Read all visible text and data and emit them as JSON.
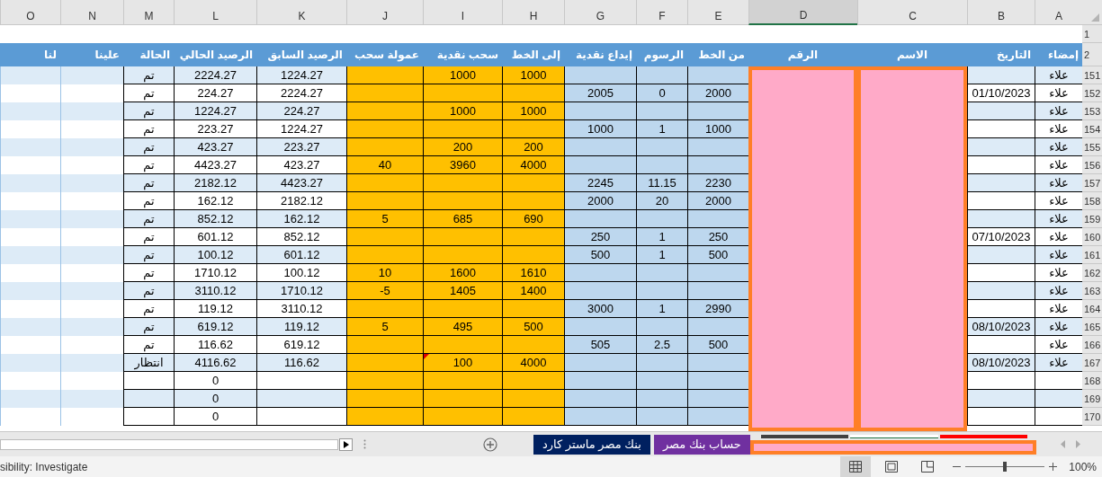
{
  "column_letters": [
    {
      "label": "O",
      "selected": false
    },
    {
      "label": "N",
      "selected": false
    },
    {
      "label": "M",
      "selected": false
    },
    {
      "label": "L",
      "selected": false
    },
    {
      "label": "K",
      "selected": false
    },
    {
      "label": "J",
      "selected": false
    },
    {
      "label": "I",
      "selected": false
    },
    {
      "label": "H",
      "selected": false
    },
    {
      "label": "G",
      "selected": false
    },
    {
      "label": "F",
      "selected": false
    },
    {
      "label": "E",
      "selected": false
    },
    {
      "label": "D",
      "selected": true
    },
    {
      "label": "C",
      "selected": false
    },
    {
      "label": "B",
      "selected": false
    },
    {
      "label": "A",
      "selected": false
    }
  ],
  "columns": [
    {
      "heading": "إمضاء",
      "kind": "striped"
    },
    {
      "heading": "التاريخ",
      "kind": "striped"
    },
    {
      "heading": "الاسم",
      "kind": "redacted"
    },
    {
      "heading": "الرقم",
      "kind": "redacted"
    },
    {
      "heading": "من الخط",
      "kind": "blue"
    },
    {
      "heading": "الرسوم",
      "kind": "blue"
    },
    {
      "heading": "إيداع نقدية",
      "kind": "blue"
    },
    {
      "heading": "إلى الخط",
      "kind": "orange"
    },
    {
      "heading": "سحب نقدية",
      "kind": "orange"
    },
    {
      "heading": "عمولة سحب",
      "kind": "orange"
    },
    {
      "heading": "الرصيد السابق",
      "kind": "striped"
    },
    {
      "heading": "الرصيد الحالي",
      "kind": "striped"
    },
    {
      "heading": "الحالة",
      "kind": "striped"
    },
    {
      "heading": "علينا",
      "kind": "open"
    },
    {
      "heading": "لنا",
      "kind": "open"
    }
  ],
  "header_rows": [
    "1",
    "2"
  ],
  "rows": [
    {
      "number": "151",
      "has_comment": false,
      "cells": [
        {},
        {},
        {
          "text": "تم"
        },
        {
          "text": "2224.27"
        },
        {
          "text": "1224.27"
        },
        {},
        {
          "text": "1000"
        },
        {
          "text": "1000"
        },
        {},
        {},
        {},
        {},
        {
          "text": "علاء"
        }
      ]
    },
    {
      "number": "152",
      "has_comment": false,
      "cells": [
        {},
        {},
        {
          "text": "تم"
        },
        {
          "text": "224.27"
        },
        {
          "text": "2224.27"
        },
        {},
        {},
        {},
        {
          "text": "2005"
        },
        {
          "text": "0"
        },
        {
          "text": "2000"
        },
        {
          "text": "01/10/2023"
        },
        {
          "text": "علاء"
        }
      ]
    },
    {
      "number": "153",
      "has_comment": false,
      "cells": [
        {},
        {},
        {
          "text": "تم"
        },
        {
          "text": "1224.27"
        },
        {
          "text": "224.27"
        },
        {},
        {
          "text": "1000"
        },
        {
          "text": "1000"
        },
        {},
        {},
        {},
        {},
        {
          "text": "علاء"
        }
      ]
    },
    {
      "number": "154",
      "has_comment": false,
      "cells": [
        {},
        {},
        {
          "text": "تم"
        },
        {
          "text": "223.27"
        },
        {
          "text": "1224.27"
        },
        {},
        {},
        {},
        {
          "text": "1000"
        },
        {
          "text": "1"
        },
        {
          "text": "1000"
        },
        {},
        {
          "text": "علاء"
        }
      ]
    },
    {
      "number": "155",
      "has_comment": false,
      "cells": [
        {},
        {},
        {
          "text": "تم"
        },
        {
          "text": "423.27"
        },
        {
          "text": "223.27"
        },
        {},
        {
          "text": "200"
        },
        {
          "text": "200"
        },
        {},
        {},
        {},
        {},
        {
          "text": "علاء"
        }
      ]
    },
    {
      "number": "156",
      "has_comment": false,
      "cells": [
        {},
        {},
        {
          "text": "تم"
        },
        {
          "text": "4423.27"
        },
        {
          "text": "423.27"
        },
        {
          "text": "40"
        },
        {
          "text": "3960"
        },
        {
          "text": "4000"
        },
        {},
        {},
        {},
        {},
        {
          "text": "علاء"
        }
      ]
    },
    {
      "number": "157",
      "has_comment": false,
      "cells": [
        {},
        {},
        {
          "text": "تم"
        },
        {
          "text": "2182.12"
        },
        {
          "text": "4423.27"
        },
        {},
        {},
        {},
        {
          "text": "2245"
        },
        {
          "text": "11.15"
        },
        {
          "text": "2230"
        },
        {},
        {
          "text": "علاء"
        }
      ]
    },
    {
      "number": "158",
      "has_comment": false,
      "cells": [
        {},
        {},
        {
          "text": "تم"
        },
        {
          "text": "162.12"
        },
        {
          "text": "2182.12"
        },
        {},
        {},
        {},
        {
          "text": "2000"
        },
        {
          "text": "20"
        },
        {
          "text": "2000"
        },
        {},
        {
          "text": "علاء"
        }
      ]
    },
    {
      "number": "159",
      "has_comment": false,
      "cells": [
        {},
        {},
        {
          "text": "تم"
        },
        {
          "text": "852.12"
        },
        {
          "text": "162.12"
        },
        {
          "text": "5"
        },
        {
          "text": "685"
        },
        {
          "text": "690"
        },
        {},
        {},
        {},
        {},
        {
          "text": "علاء"
        }
      ]
    },
    {
      "number": "160",
      "has_comment": false,
      "cells": [
        {},
        {},
        {
          "text": "تم"
        },
        {
          "text": "601.12"
        },
        {
          "text": "852.12"
        },
        {},
        {},
        {},
        {
          "text": "250"
        },
        {
          "text": "1"
        },
        {
          "text": "250"
        },
        {
          "text": "07/10/2023"
        },
        {
          "text": "علاء"
        }
      ]
    },
    {
      "number": "161",
      "has_comment": false,
      "cells": [
        {},
        {},
        {
          "text": "تم"
        },
        {
          "text": "100.12"
        },
        {
          "text": "601.12"
        },
        {},
        {},
        {},
        {
          "text": "500"
        },
        {
          "text": "1"
        },
        {
          "text": "500"
        },
        {},
        {
          "text": "علاء"
        }
      ]
    },
    {
      "number": "162",
      "has_comment": false,
      "cells": [
        {},
        {},
        {
          "text": "تم"
        },
        {
          "text": "1710.12"
        },
        {
          "text": "100.12"
        },
        {
          "text": "10"
        },
        {
          "text": "1600"
        },
        {
          "text": "1610"
        },
        {},
        {},
        {},
        {},
        {
          "text": "علاء"
        }
      ]
    },
    {
      "number": "163",
      "has_comment": false,
      "cells": [
        {},
        {},
        {
          "text": "تم"
        },
        {
          "text": "3110.12"
        },
        {
          "text": "1710.12"
        },
        {
          "text": "-5"
        },
        {
          "text": "1405"
        },
        {
          "text": "1400"
        },
        {},
        {},
        {},
        {},
        {
          "text": "علاء"
        }
      ]
    },
    {
      "number": "164",
      "has_comment": false,
      "cells": [
        {},
        {},
        {
          "text": "تم"
        },
        {
          "text": "119.12"
        },
        {
          "text": "3110.12"
        },
        {},
        {},
        {},
        {
          "text": "3000"
        },
        {
          "text": "1"
        },
        {
          "text": "2990"
        },
        {},
        {
          "text": "علاء"
        }
      ]
    },
    {
      "number": "165",
      "has_comment": false,
      "cells": [
        {},
        {},
        {
          "text": "تم"
        },
        {
          "text": "619.12"
        },
        {
          "text": "119.12"
        },
        {
          "text": "5"
        },
        {
          "text": "495"
        },
        {
          "text": "500"
        },
        {},
        {},
        {},
        {
          "text": "08/10/2023"
        },
        {
          "text": "علاء"
        }
      ]
    },
    {
      "number": "166",
      "has_comment": false,
      "cells": [
        {},
        {},
        {
          "text": "تم"
        },
        {
          "text": "116.62"
        },
        {
          "text": "619.12"
        },
        {},
        {},
        {},
        {
          "text": "505"
        },
        {
          "text": "2.5"
        },
        {
          "text": "500"
        },
        {},
        {
          "text": "علاء"
        }
      ]
    },
    {
      "number": "167",
      "has_comment": true,
      "cells": [
        {},
        {},
        {
          "text": "انتظار"
        },
        {
          "text": "4116.62"
        },
        {
          "text": "116.62"
        },
        {},
        {
          "text": "100"
        },
        {
          "text": "4000"
        },
        {},
        {},
        {},
        {
          "text": "08/10/2023"
        },
        {
          "text": "علاء"
        }
      ]
    },
    {
      "number": "168",
      "has_comment": false,
      "cells": [
        {},
        {},
        {},
        {
          "text": "0"
        },
        {},
        {},
        {},
        {},
        {},
        {},
        {},
        {},
        {}
      ]
    },
    {
      "number": "169",
      "has_comment": false,
      "cells": [
        {},
        {},
        {},
        {
          "text": "0"
        },
        {},
        {},
        {},
        {},
        {},
        {},
        {},
        {},
        {}
      ]
    },
    {
      "number": "170",
      "has_comment": false,
      "cells": [
        {},
        {},
        {},
        {
          "text": "0"
        },
        {},
        {},
        {},
        {},
        {},
        {},
        {},
        {},
        {}
      ]
    }
  ],
  "sheet_tabs": [
    {
      "color": "#ff0000",
      "kind": "hidden",
      "selected": false
    },
    {
      "color": "#ffffff",
      "kind": "hidden",
      "selected": true
    },
    {
      "color": "#404040",
      "kind": "hidden",
      "selected": false
    },
    {
      "label": "حساب بنك مصر",
      "color": "#7030a0",
      "kind": "named",
      "selected": false
    },
    {
      "label": "بنك مصر ماستر كارد",
      "color": "#002060",
      "kind": "named",
      "selected": false
    }
  ],
  "status_bar": {
    "message": "sibility: Investigate",
    "zoom": {
      "level": 0.5,
      "reading": "100%"
    }
  }
}
